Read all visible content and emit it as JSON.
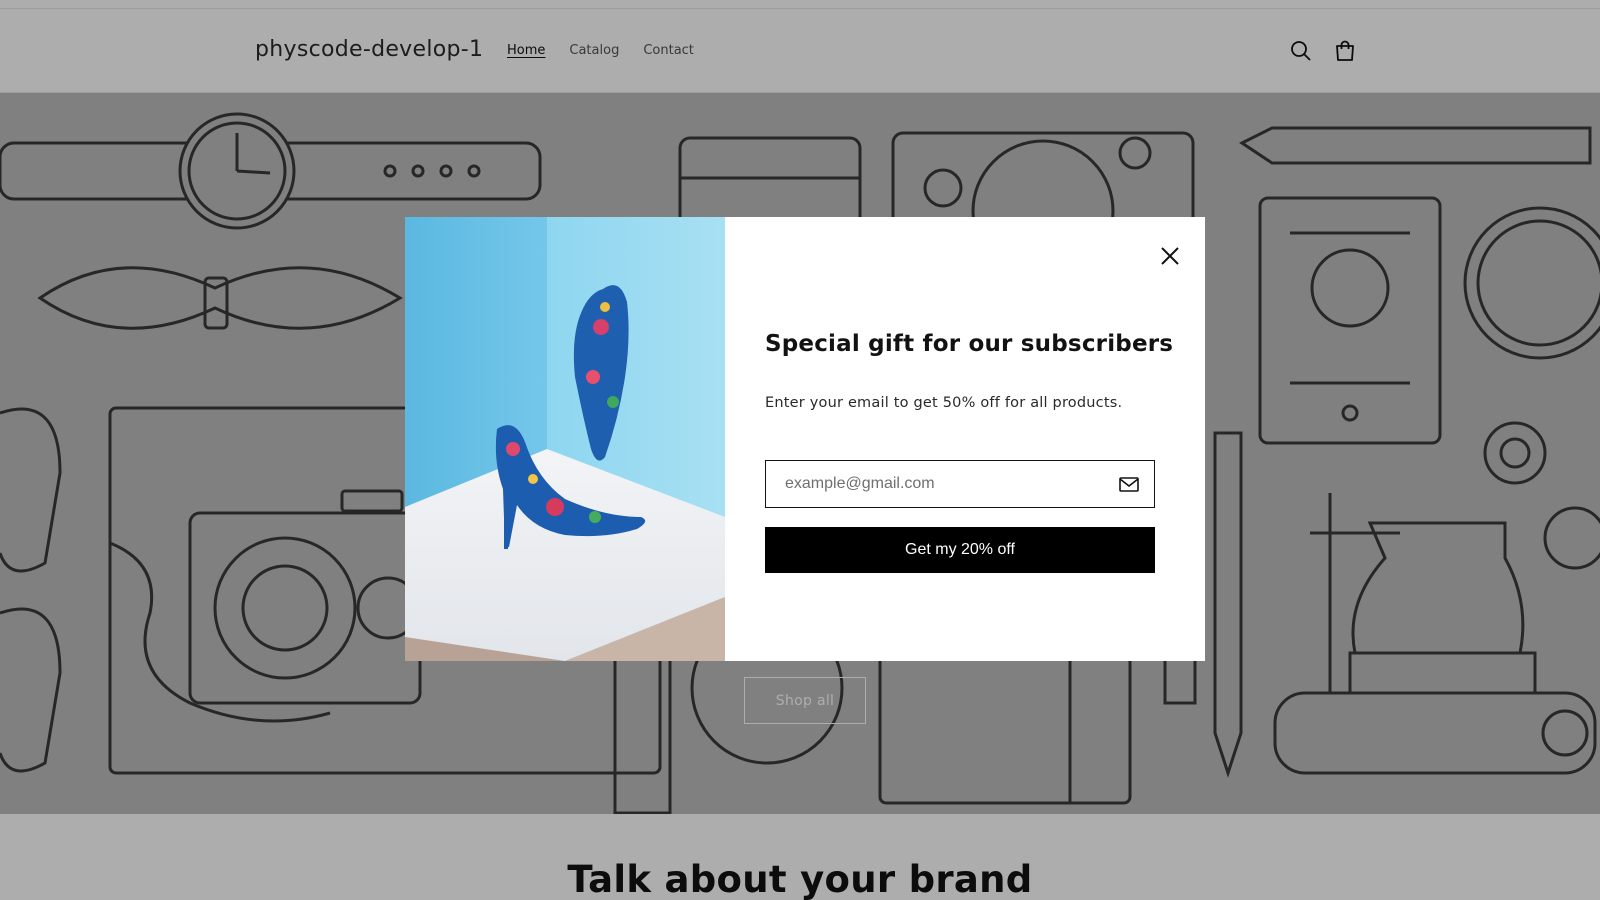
{
  "header": {
    "store_name": "physcode-develop-1",
    "nav": [
      "Home",
      "Catalog",
      "Contact"
    ],
    "icons": [
      "search-icon",
      "cart-icon"
    ]
  },
  "hero": {
    "shop_all_label": "Shop all"
  },
  "brand_section": {
    "title": "Talk about your brand"
  },
  "popup": {
    "title": "Special gift for our subscribers",
    "description": "Enter your email to get 50% off for all products.",
    "email_placeholder": "example@gmail.com",
    "email_value": "",
    "submit_label": "Get my 20% off",
    "close_icon": "close-icon",
    "mail_icon": "mail-icon"
  },
  "colors": {
    "overlay": "rgba(0,0,0,0.32)",
    "button_bg": "#000000",
    "button_text": "#ffffff",
    "hero_bg": "#bdbdbd",
    "image_wall": "#8fd3ec",
    "image_floor": "#eef0f3"
  }
}
